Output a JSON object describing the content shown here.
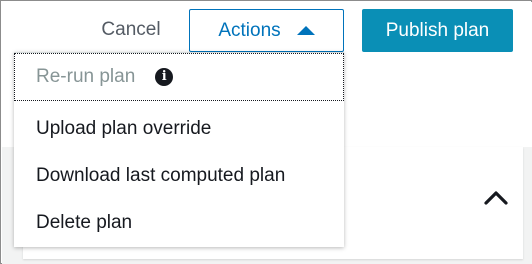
{
  "toolbar": {
    "cancel_label": "Cancel",
    "actions_label": "Actions",
    "publish_label": "Publish plan"
  },
  "actions_menu": {
    "expanded": true,
    "items": [
      {
        "label": "Re-run plan",
        "disabled": true,
        "icon": "info-icon",
        "icon_glyph": "i"
      },
      {
        "label": "Upload plan override",
        "disabled": false
      },
      {
        "label": "Download last computed plan",
        "disabled": false
      },
      {
        "label": "Delete plan",
        "disabled": false
      }
    ]
  },
  "panel": {
    "collapse_icon": "chevron-up-icon"
  },
  "colors": {
    "accent": "#0073bb",
    "primary_button": "#0a8fb6",
    "text": "#16191f",
    "disabled_text": "#879596",
    "muted_text": "#545b64",
    "page_background": "#f2f3f3"
  }
}
